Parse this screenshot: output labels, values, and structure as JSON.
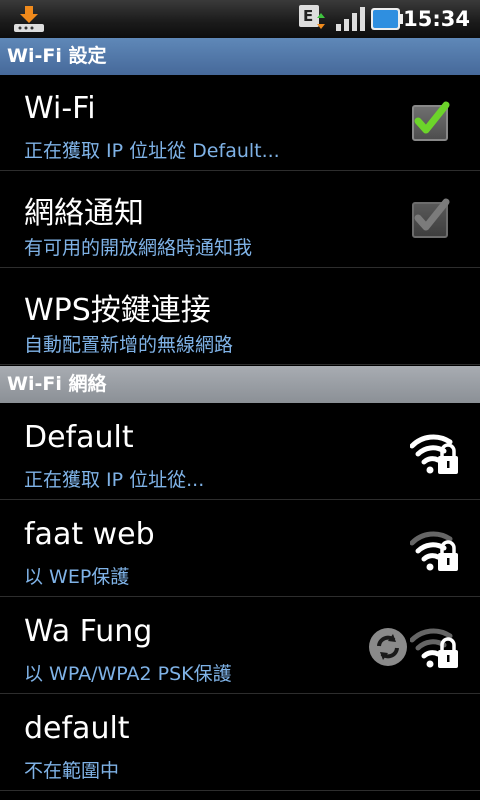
{
  "status_bar": {
    "time": "15:34",
    "network_type": "E",
    "icons": [
      "download-icon",
      "edge-network-icon",
      "signal-icon",
      "battery-icon"
    ]
  },
  "sections": {
    "wifi_settings": {
      "title": "Wi-Fi 設定"
    },
    "wifi_networks": {
      "title": "Wi-Fi 網絡"
    }
  },
  "settings": [
    {
      "title": "Wi-Fi",
      "subtitle": "正在獲取 IP 位址從 Default...",
      "checked": true
    },
    {
      "title": "網絡通知",
      "subtitle": "有可用的開放網絡時通知我",
      "checked": true
    },
    {
      "title": "WPS按鍵連接",
      "subtitle": "自動配置新增的無線網路"
    }
  ],
  "networks": [
    {
      "name": "Default",
      "status": "正在獲取 IP 位址從...",
      "secured": true
    },
    {
      "name": "faat web",
      "status": "以 WEP保護",
      "secured": true
    },
    {
      "name": "Wa Fung",
      "status": "以 WPA/WPA2 PSK保護",
      "secured": true,
      "wps": true
    },
    {
      "name": "default",
      "status": "不在範圍中"
    }
  ],
  "colors": {
    "header_blue": "#5f88b8",
    "header_gray": "#9a9ea4",
    "subtitle": "#7fb2e6",
    "check_green": "#6cd42a"
  }
}
